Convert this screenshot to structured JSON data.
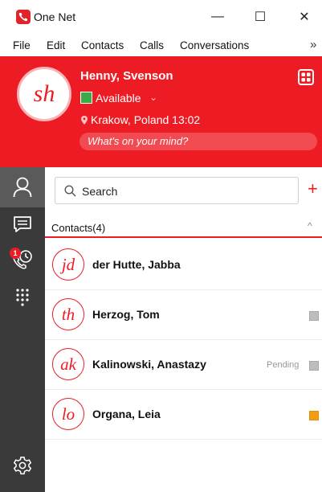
{
  "window": {
    "title": "One Net",
    "minimize": "—",
    "maximize": "☐",
    "close": "✕"
  },
  "menu": {
    "items": [
      "File",
      "Edit",
      "Contacts",
      "Calls",
      "Conversations"
    ],
    "more": "»"
  },
  "profile": {
    "initials": "sh",
    "name": "Henny, Svenson",
    "status": "Available",
    "status_caret": "⌄",
    "location": "Krakow, Poland  13:02",
    "mind_placeholder": "What's on your mind?",
    "status_color": "#3aab47"
  },
  "sidebar": {
    "icons": [
      "person-icon",
      "chat-icon",
      "call-history-icon",
      "dialpad-icon",
      "gear-icon"
    ],
    "call_history_badge": "1"
  },
  "search": {
    "placeholder": "Search",
    "add_label": "+"
  },
  "contacts": {
    "section_title": "Contacts(4)",
    "section_caret": "^",
    "items": [
      {
        "initials": "jd",
        "name": "der Hutte, Jabba",
        "status_label": ""
      },
      {
        "initials": "th",
        "name": "Herzog, Tom",
        "status_label": ""
      },
      {
        "initials": "ak",
        "name": "Kalinowski, Anastazy",
        "status_label": "Pending"
      },
      {
        "initials": "lo",
        "name": "Organa, Leia",
        "status_label": ""
      }
    ]
  },
  "colors": {
    "brand_red": "#ed1c24",
    "sidebar_dark": "#3a3a3a",
    "presence_gray": "#bdbdbd",
    "presence_orange": "#f39c12"
  }
}
